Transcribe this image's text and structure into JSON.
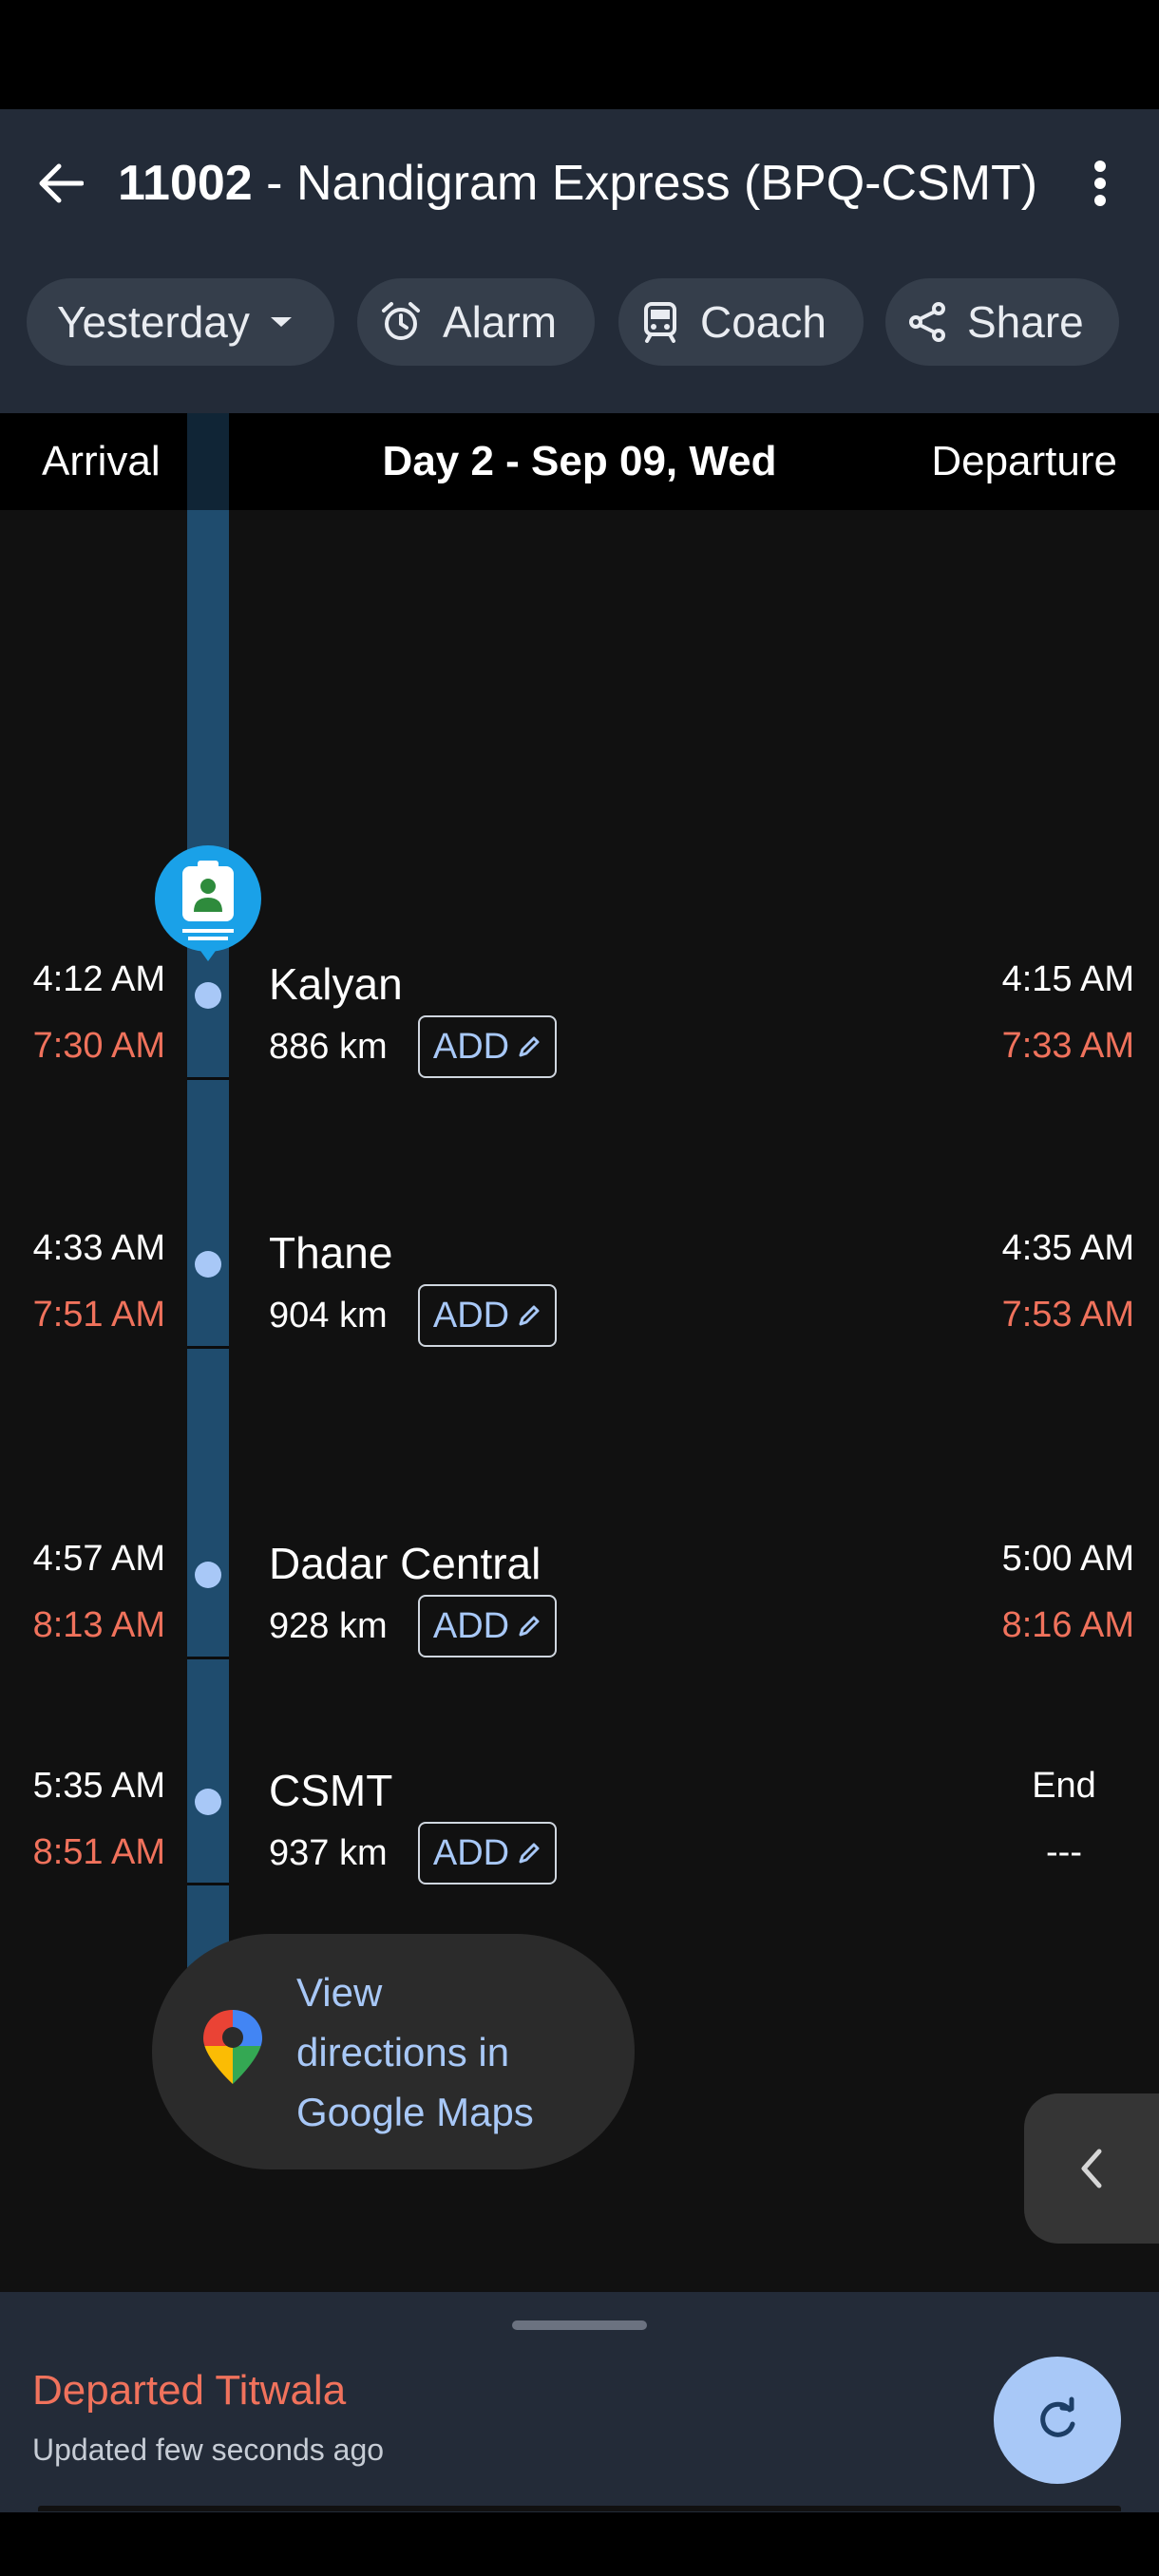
{
  "header": {
    "train_number": "11002",
    "train_name": " - Nandigram Express (BPQ-CSMT)"
  },
  "chips": {
    "day": "Yesterday",
    "alarm": "Alarm",
    "coach": "Coach",
    "share": "Share"
  },
  "day_bar": {
    "arrival_label": "Arrival",
    "date_label": "Day 2 - Sep 09, Wed",
    "departure_label": "Departure"
  },
  "stations": [
    {
      "name": "Kalyan",
      "distance": "886 km",
      "arr_sched": "4:12 AM",
      "arr_actual": "7:30 AM",
      "dep_sched": "4:15 AM",
      "dep_actual": "7:33 AM",
      "add_label": "ADD"
    },
    {
      "name": "Thane",
      "distance": "904 km",
      "arr_sched": "4:33 AM",
      "arr_actual": "7:51 AM",
      "dep_sched": "4:35 AM",
      "dep_actual": "7:53 AM",
      "add_label": "ADD"
    },
    {
      "name": "Dadar Central",
      "distance": "928 km",
      "arr_sched": "4:57 AM",
      "arr_actual": "8:13 AM",
      "dep_sched": "5:00 AM",
      "dep_actual": "8:16 AM",
      "add_label": "ADD"
    },
    {
      "name": "CSMT",
      "distance": "937 km",
      "arr_sched": "5:35 AM",
      "arr_actual": "8:51 AM",
      "dep_sched": "End",
      "dep_actual": "---",
      "add_label": "ADD"
    }
  ],
  "maps_button": {
    "line1": "View",
    "line2": "directions in",
    "line3": "Google Maps"
  },
  "status": {
    "main": "Departed Titwala",
    "sub": "Updated few seconds ago"
  },
  "colors": {
    "accent_blue": "#a8c8f7",
    "delay_red": "#f0725c",
    "app_bar": "#232b38",
    "track": "#1f4c6e"
  },
  "icons": {
    "back": "arrow-left-icon",
    "more": "more-vertical-icon",
    "dropdown": "caret-down-icon",
    "alarm": "alarm-clock-icon",
    "coach": "train-coach-icon",
    "share": "share-icon",
    "edit": "pencil-icon",
    "maps": "google-maps-pin-icon",
    "collapse": "chevron-left-icon",
    "refresh": "refresh-icon",
    "train": "train-marker-icon"
  }
}
